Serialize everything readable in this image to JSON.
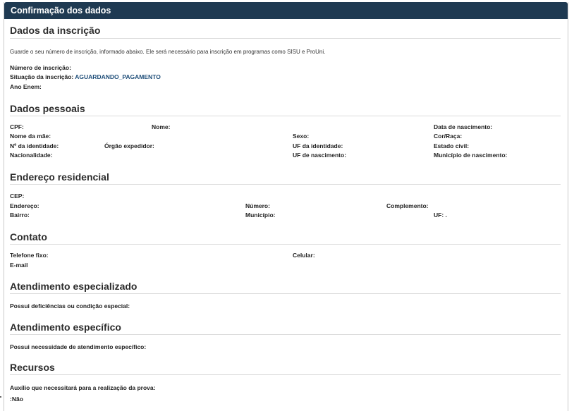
{
  "panel": {
    "header": "Confirmação dos dados"
  },
  "inscricao": {
    "title": "Dados da inscrição",
    "note": "Guarde o seu número de inscrição, informado abaixo. Ele será necessário para inscrição em programas como SISU e ProUni.",
    "numero_label": "Número de inscrição:",
    "situacao_label": "Situação da inscrição:",
    "situacao_value": "AGUARDANDO_PAGAMENTO",
    "ano_label": "Ano Enem:"
  },
  "pessoais": {
    "title": "Dados pessoais",
    "cpf": "CPF:",
    "nome": "Nome:",
    "nascimento": "Data de nascimento:",
    "mae": "Nome da mãe:",
    "sexo": "Sexo:",
    "cor": "Cor/Raça:",
    "identidade": "Nº da identidade:",
    "orgao": "Órgão expedidor:",
    "uf_identidade": "UF da identidade:",
    "estado_civil": "Estado civil:",
    "nacionalidade": "Nacionalidade:",
    "uf_nascimento": "UF de nascimento:",
    "municipio_nascimento": "Município de nascimento:"
  },
  "endereco": {
    "title": "Endereço residencial",
    "cep": "CEP:",
    "endereco": "Endereço:",
    "numero": "Número:",
    "complemento": "Complemento:",
    "bairro": "Bairro:",
    "municipio": "Município:",
    "uf": "UF:",
    "uf_value": "."
  },
  "contato": {
    "title": "Contato",
    "telefone": "Telefone fixo:",
    "celular": "Celular:",
    "email": "E-mail"
  },
  "especializado": {
    "title": "Atendimento especializado",
    "label": "Possui deficiências ou condição especial:"
  },
  "especifico": {
    "title": "Atendimento específico",
    "label": "Possui necessidade de atendimento específico:"
  },
  "recursos": {
    "title": "Recursos",
    "label": "Auxílio que necessitará para a realização da prova:",
    "value": ":Não"
  }
}
